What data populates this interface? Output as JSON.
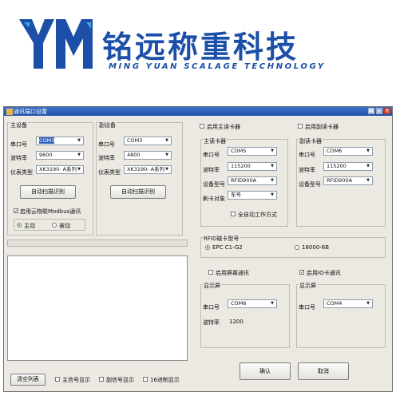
{
  "brand": {
    "logo_letters": "YM",
    "name_cn": "铭远称重科技",
    "name_en": "MING YUAN SCALAGE TECHNOLOGY",
    "color": "#1b4fa8"
  },
  "window": {
    "title": "通讯端口设置",
    "title_icon": "app-icon",
    "controls": [
      "minimize-icon",
      "maximize-icon",
      "close-icon"
    ]
  },
  "main_device": {
    "title": "主设备",
    "port_label": "串口号",
    "port_value": "COM3",
    "baud_label": "波特率",
    "baud_value": "9600",
    "type_label": "仪表类型",
    "type_value": "XK3190- A系列",
    "scan_button": "自动扫描识别",
    "cloud_label": "启用云物联Modbus通讯",
    "cloud_checked": true,
    "radio_master": "主动",
    "radio_slave": "被动"
  },
  "sub_device": {
    "title": "副设备",
    "port_label": "串口号",
    "port_value": "COM3",
    "baud_label": "波特率",
    "baud_value": "4800",
    "type_label": "仪表类型",
    "type_value": "XK3190- A系列",
    "scan_button": "自动扫描识别"
  },
  "main_reader": {
    "enable_label": "启用主读卡器",
    "title": "主读卡器",
    "port_label": "串口号",
    "port_value": "COM5",
    "baud_label": "波特率",
    "baud_value": "115200",
    "model_label": "设备型号",
    "model_value": "RFID900A",
    "target_label": "刷卡对象",
    "target_value": "车号",
    "auto_label": "全自动工作方式"
  },
  "sub_reader": {
    "enable_label": "启用副读卡器",
    "title": "副读卡器",
    "port_label": "串口号",
    "port_value": "COM6",
    "baud_label": "波特率",
    "baud_value": "115200",
    "model_label": "设备型号",
    "model_value": "RFID900A"
  },
  "rfid": {
    "title": "RFID磁卡型号",
    "opt1": "EPC C1-G2",
    "opt2": "18000-6B"
  },
  "screen": {
    "enable_label": "启用屏幕通讯",
    "title": "显示屏",
    "port_label": "串口号",
    "port_value": "COM6",
    "baud_label": "波特率",
    "baud_value": "1200"
  },
  "io": {
    "enable_label": "启用IO卡通讯",
    "enable_checked": true,
    "title": "显示屏",
    "port_label": "串口号",
    "port_value": "COM4"
  },
  "footer": {
    "clear_button": "清空列表",
    "main_signal": "主信号显示",
    "sub_signal": "副信号显示",
    "hex_display": "16进制显示",
    "ok_button": "确认",
    "cancel_button": "取消"
  }
}
